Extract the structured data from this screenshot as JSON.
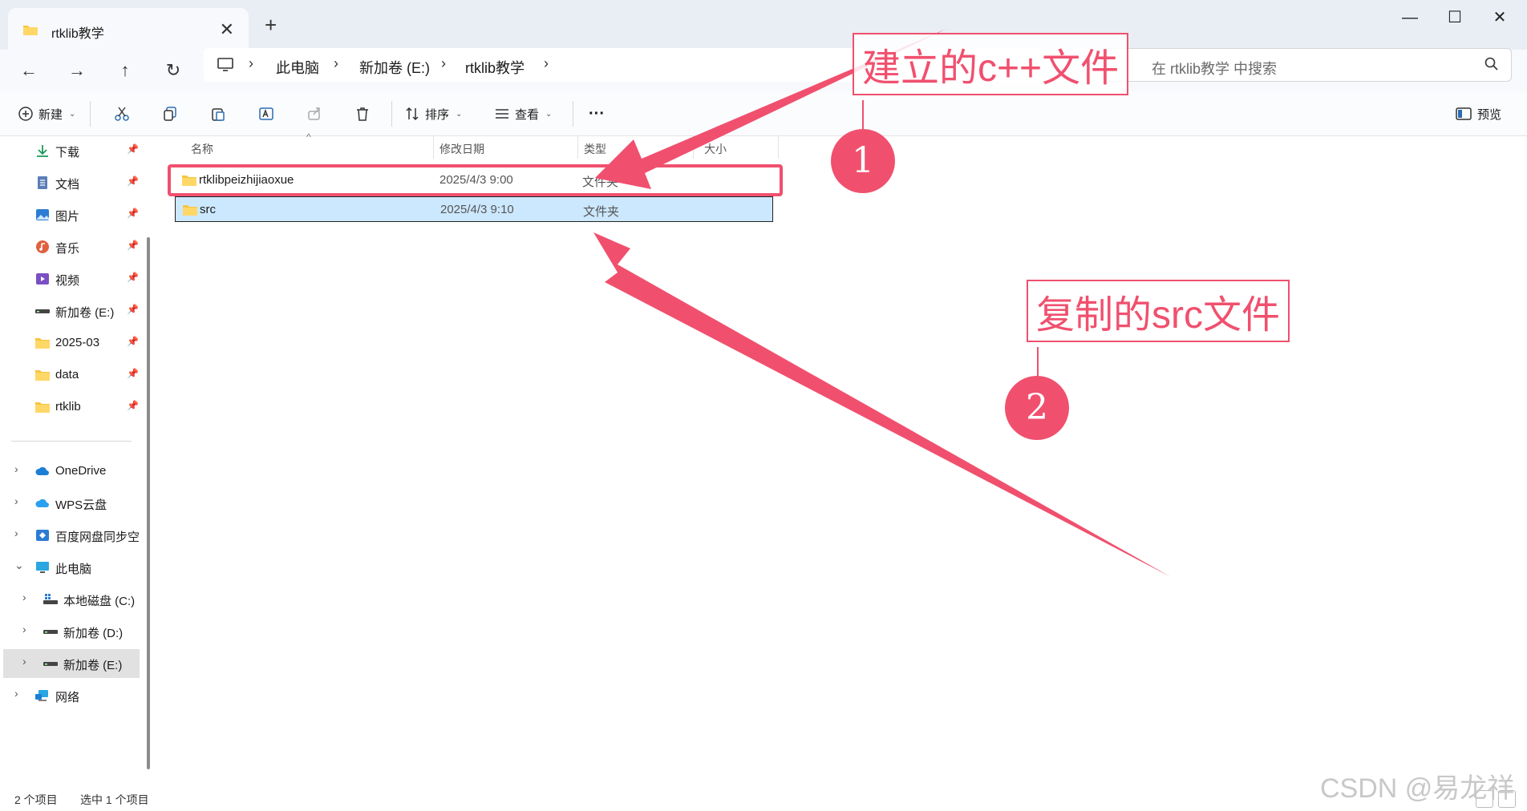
{
  "window": {
    "tab_title": "rtklib教学",
    "new_tab": "+",
    "close_tab": "✕",
    "minimize": "—",
    "maximize": "☐",
    "close": "✕"
  },
  "address": {
    "crumbs": [
      "此电脑",
      "新加卷 (E:)",
      "rtklib教学"
    ],
    "search_placeholder": "在 rtklib教学 中搜索"
  },
  "toolbar": {
    "new_label": "新建",
    "sort_label": "排序",
    "view_label": "查看",
    "more_label": "···",
    "preview_label": "预览"
  },
  "sidebar": {
    "quick_access": [
      {
        "label": "下载",
        "icon": "download-icon"
      },
      {
        "label": "文档",
        "icon": "document-icon"
      },
      {
        "label": "图片",
        "icon": "picture-icon"
      },
      {
        "label": "音乐",
        "icon": "music-icon"
      },
      {
        "label": "视频",
        "icon": "video-icon"
      },
      {
        "label": "新加卷 (E:)",
        "icon": "drive-icon"
      },
      {
        "label": "2025-03",
        "icon": "folder-icon"
      },
      {
        "label": "data",
        "icon": "folder-icon"
      },
      {
        "label": "rtklib",
        "icon": "folder-icon"
      }
    ],
    "tree": [
      {
        "label": "OneDrive",
        "icon": "cloud-icon"
      },
      {
        "label": "WPS云盘",
        "icon": "cloud-icon"
      },
      {
        "label": "百度网盘同步空",
        "icon": "baidu-icon"
      },
      {
        "label": "此电脑",
        "icon": "computer-icon"
      },
      {
        "label": "本地磁盘 (C:)",
        "icon": "windows-drive-icon"
      },
      {
        "label": "新加卷 (D:)",
        "icon": "drive-icon"
      },
      {
        "label": "新加卷 (E:)",
        "icon": "drive-icon"
      },
      {
        "label": "网络",
        "icon": "network-icon"
      }
    ]
  },
  "columns": [
    "名称",
    "修改日期",
    "类型",
    "大小"
  ],
  "files": [
    {
      "name": "rtklibpeizhijiaoxue",
      "date": "2025/4/3 9:00",
      "type": "文件夹"
    },
    {
      "name": "src",
      "date": "2025/4/3 9:10",
      "type": "文件夹"
    }
  ],
  "status": {
    "count": "2 个项目",
    "selected": "选中 1 个项目"
  },
  "annotations": {
    "label1": "建立的c++文件",
    "num1": "1",
    "label2": "复制的src文件",
    "num2": "2",
    "color": "#f0506e"
  },
  "watermark": "CSDN @易龙祥"
}
